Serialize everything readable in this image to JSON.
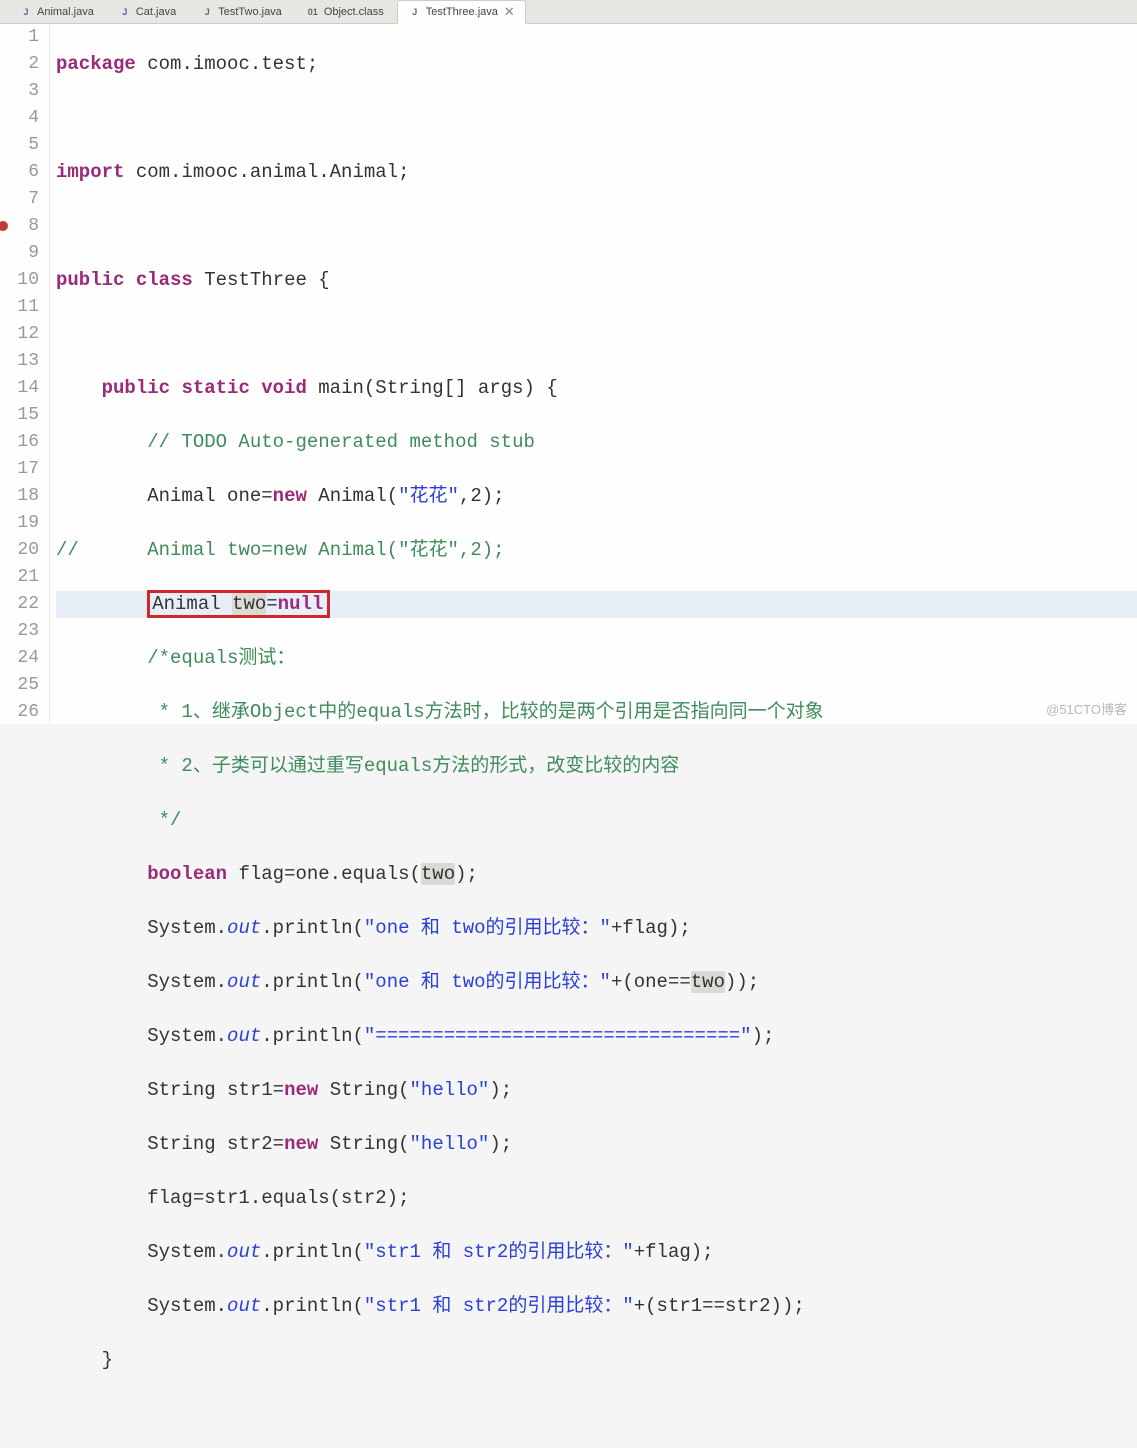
{
  "tabs": [
    {
      "label": "Animal.java",
      "icon": "J"
    },
    {
      "label": "Cat.java",
      "icon": "J"
    },
    {
      "label": "TestTwo.java",
      "icon": "J"
    },
    {
      "label": "Object.class",
      "icon": "01"
    },
    {
      "label": "TestThree.java",
      "icon": "J",
      "active": true
    }
  ],
  "lines": {
    "l1": {
      "n": "1"
    },
    "l2": {
      "n": "2"
    },
    "l3": {
      "n": "3"
    },
    "l4": {
      "n": "4"
    },
    "l5": {
      "n": "5"
    },
    "l6": {
      "n": "6"
    },
    "l7": {
      "n": "7"
    },
    "l8": {
      "n": "8"
    },
    "l9": {
      "n": "9"
    },
    "l10": {
      "n": "10"
    },
    "l11": {
      "n": "11"
    },
    "l12": {
      "n": "12"
    },
    "l13": {
      "n": "13"
    },
    "l14": {
      "n": "14"
    },
    "l15": {
      "n": "15"
    },
    "l16": {
      "n": "16"
    },
    "l17": {
      "n": "17"
    },
    "l18": {
      "n": "18"
    },
    "l19": {
      "n": "19"
    },
    "l20": {
      "n": "20"
    },
    "l21": {
      "n": "21"
    },
    "l22": {
      "n": "22"
    },
    "l23": {
      "n": "23"
    },
    "l24": {
      "n": "24"
    },
    "l25": {
      "n": "25"
    },
    "l26": {
      "n": "26"
    }
  },
  "code": {
    "pkg_kw": "package",
    "pkg": "com.imooc.test",
    "imp_kw": "import",
    "imp": "com.imooc.animal.Animal",
    "pub": "public",
    "cls": "class",
    "clsName": "TestThree",
    "stat": "static",
    "void": "void",
    "main": "main",
    "args": "String[] args",
    "todo": "// TODO Auto-generated method stub",
    "Animal": "Animal",
    "one": "one",
    "new": "new",
    "hua": "\"花花\"",
    "n2": "2",
    "cmt_line": "//",
    "two": "two",
    "null": "null",
    "c12": "/*equals测试：",
    "c13": " * 1、继承Object中的equals方法时，比较的是两个引用是否指向同一个对象",
    "c14": " * 2、子类可以通过重写equals方法的形式，改变比较的内容",
    "c15": " */",
    "bool": "boolean",
    "flag": "flag",
    "eq": "equals",
    "Sys": "System",
    "out": "out",
    "println": "println",
    "s17": "\"one 和 two的引用比较：\"",
    "s18": "\"one 和 two的引用比较：\"",
    "s19": "\"================================\"",
    "Str": "String",
    "str1": "str1",
    "str2": "str2",
    "hello": "\"hello\"",
    "s23": "\"str1 和 str2的引用比较：\"",
    "s24": "\"str1 和 str2的引用比较：\""
  },
  "watermark": "@51CTO博客"
}
